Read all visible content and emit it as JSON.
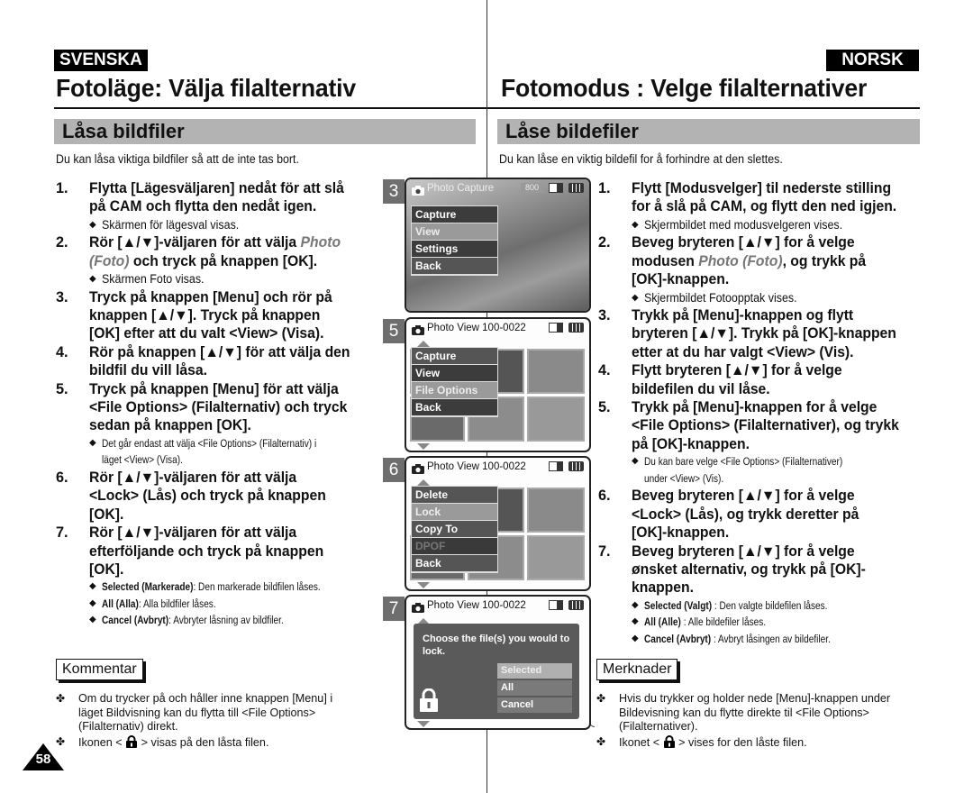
{
  "swedish": {
    "lang_label": "SVENSKA",
    "title": "Fotoläge: Välja filalternativ",
    "section": "Låsa bildfiler",
    "intro": "Du kan låsa viktiga bildfiler så att de inte tas bort.",
    "steps": [
      {
        "num": "1.",
        "text": "Flytta [Lägesväljaren] nedåt för att slå\npå CAM och flytta den nedåt igen.",
        "notes": [
          "Skärmen för lägesval visas."
        ]
      },
      {
        "num": "2.",
        "text_pre": "Rör [▲/▼]-väljaren för att välja ",
        "text_italic": "Photo\n(Foto)",
        "text_post": " och tryck på knappen [OK].",
        "notes": [
          "Skärmen Foto visas."
        ]
      },
      {
        "num": "3.",
        "text": "Tryck på knappen [Menu] och rör på\nknappen [▲/▼]. Tryck på knappen\n[OK] efter att du valt <View> (Visa).",
        "notes": []
      },
      {
        "num": "4.",
        "text": "Rör på knappen [▲/▼] för att välja den\nbildfil du vill låsa.",
        "notes": []
      },
      {
        "num": "5.",
        "text": "Tryck på knappen [Menu] för att välja\n<File Options> (Filalternativ) och tryck\nsedan på knappen [OK].",
        "notes": [
          "Det går endast att välja <File Options> (Filalternativ) i\nläget <View> (Visa)."
        ]
      },
      {
        "num": "6.",
        "text": "Rör [▲/▼]-väljaren för att välja\n<Lock> (Lås) och tryck på knappen\n[OK].",
        "notes": []
      },
      {
        "num": "7.",
        "text": "Rör [▲/▼]-väljaren för att välja\nefterföljande och tryck på knappen\n[OK].",
        "notes": []
      }
    ],
    "options": [
      {
        "term": "Selected (Markerade)",
        "desc": ": Den markerade bildfilen låses."
      },
      {
        "term": "All (Alla)",
        "desc": ": Alla bildfiler låses."
      },
      {
        "term": "Cancel (Avbryt)",
        "desc": ": Avbryter låsning av bildfiler."
      }
    ],
    "comment_label": "Kommentar",
    "comments": [
      "Om du trycker på och håller inne knappen [Menu] i\nläget Bildvisning kan du flytta till <File Options>\n(Filalternativ) direkt.",
      {
        "pre": "Ikonen < ",
        "post": " > visas på den låsta filen."
      }
    ]
  },
  "norwegian": {
    "lang_label": "NORSK",
    "title": "Fotomodus : Velge filalternativer",
    "section": "Låse bildefiler",
    "intro": "Du kan låse en viktig bildefil for å forhindre at den slettes.",
    "steps": [
      {
        "num": "1.",
        "text": "Flytt [Modusvelger] til nederste stilling\nfor å slå på CAM, og flytt den ned igjen.",
        "notes": [
          "Skjermbildet med modusvelgeren vises."
        ]
      },
      {
        "num": "2.",
        "text_pre": "Beveg bryteren [▲/▼] for å velge\nmodusen ",
        "text_italic": "Photo (Foto)",
        "text_post": ", og trykk på\n[OK]-knappen.",
        "notes": [
          "Skjermbildet Fotoopptak vises."
        ]
      },
      {
        "num": "3.",
        "text": "Trykk på [Menu]-knappen og flytt\nbryteren [▲/▼]. Trykk på [OK]-knappen\netter at du har valgt <View> (Vis).",
        "notes": []
      },
      {
        "num": "4.",
        "text": "Flytt bryteren [▲/▼] for å velge\nbildefilen du vil låse.",
        "notes": []
      },
      {
        "num": "5.",
        "text": "Trykk på [Menu]-knappen for å velge\n<File Options> (Filalternativer), og trykk\npå [OK]-knappen.",
        "notes": [
          "Du kan bare velge <File Options> (Filalternativer)\nunder <View> (Vis)."
        ]
      },
      {
        "num": "6.",
        "text": "Beveg bryteren [▲/▼] for å velge\n<Lock> (Lås), og trykk deretter på\n[OK]-knappen.",
        "notes": []
      },
      {
        "num": "7.",
        "text": "Beveg bryteren [▲/▼] for å velge\nønsket alternativ, og trykk på [OK]-\nknappen.",
        "notes": []
      }
    ],
    "options": [
      {
        "term": "Selected (Valgt)",
        "desc": " : Den valgte bildefilen låses."
      },
      {
        "term": "All (Alle)",
        "desc": " : Alle bildefiler låses."
      },
      {
        "term": "Cancel (Avbryt)",
        "desc": " : Avbryt låsingen av bildefiler."
      }
    ],
    "comment_label": "Merknader",
    "comments": [
      "Hvis du trykker og holder nede [Menu]-knappen under\nBildevisning kan du flytte direkte til <File Options>\n(Filalternativer).",
      {
        "pre": "Ikonet < ",
        "post": " > vises for den låste filen."
      }
    ]
  },
  "screens": [
    {
      "num": "3",
      "header": "Photo Capture",
      "resolution": "800",
      "menu": [
        "Capture",
        "View",
        "Settings",
        "Back"
      ],
      "highlighted": "View"
    },
    {
      "num": "5",
      "header": "Photo View  100-0022",
      "menu": [
        "Capture",
        "View",
        "File Options",
        "Back"
      ],
      "highlighted": "File Options"
    },
    {
      "num": "6",
      "header": "Photo View  100-0022",
      "menu": [
        "Delete",
        "Lock",
        "Copy To",
        "DPOF",
        "Back"
      ],
      "highlighted": "Lock",
      "disabled": "DPOF"
    },
    {
      "num": "7",
      "header": "Photo View  100-0022",
      "dialog_message": "Choose the file(s) you would to lock.",
      "dialog_options": [
        "Selected",
        "All",
        "Cancel"
      ],
      "highlighted": "Selected"
    }
  ],
  "page_number": "58",
  "icons": {
    "camera": "camera-icon",
    "memory": "internal-memory-icon",
    "battery": "battery-icon",
    "lock": "lock-icon",
    "bullet": "diamond",
    "comment_bullet": "four-leaf-bullet"
  }
}
